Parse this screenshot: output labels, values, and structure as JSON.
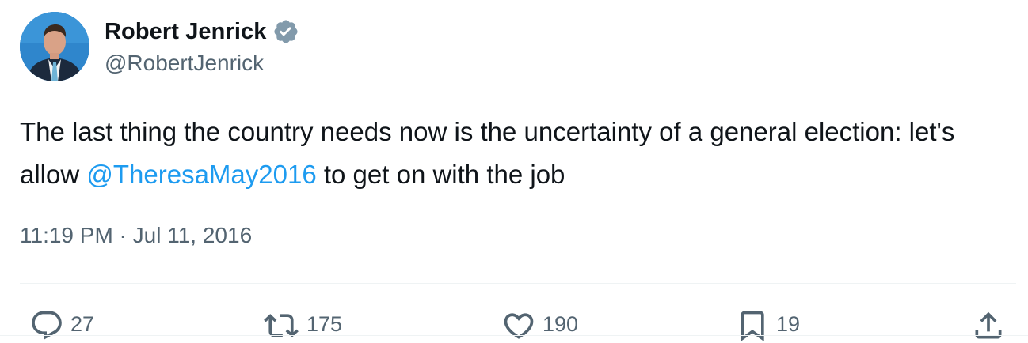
{
  "author": {
    "name": "Robert Jenrick",
    "handle": "@RobertJenrick",
    "verified_color": "#829aab"
  },
  "tweet": {
    "text_before": "The last thing the country needs now is the uncertainty of a general election: let's allow ",
    "mention": "@TheresaMay2016",
    "text_after": " to get on with the job",
    "timestamp": "11:19 PM · Jul 11, 2016"
  },
  "actions": {
    "reply_count": "27",
    "retweet_count": "175",
    "like_count": "190",
    "bookmark_count": "19"
  },
  "colors": {
    "link": "#1d9bf0",
    "secondary_text": "#536471"
  }
}
